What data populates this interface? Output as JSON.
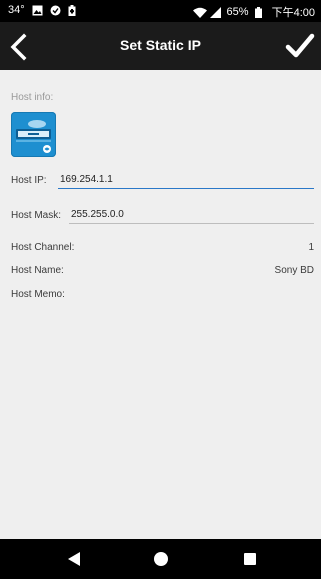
{
  "status_bar": {
    "temperature": "34°",
    "battery": "65%",
    "time": "下午4:00"
  },
  "header": {
    "title": "Set Static IP"
  },
  "form": {
    "section_label": "Host info:",
    "host_ip_label": "Host IP:",
    "host_ip_value": "169.254.1.1",
    "host_mask_label": "Host Mask:",
    "host_mask_value": "255.255.0.0",
    "host_channel_label": "Host Channel:",
    "host_channel_value": "1",
    "host_name_label": "Host Name:",
    "host_name_value": "Sony BD",
    "host_memo_label": "Host Memo:"
  },
  "colors": {
    "accent": "#2a78c8",
    "device_icon": "#1e8fd0"
  }
}
